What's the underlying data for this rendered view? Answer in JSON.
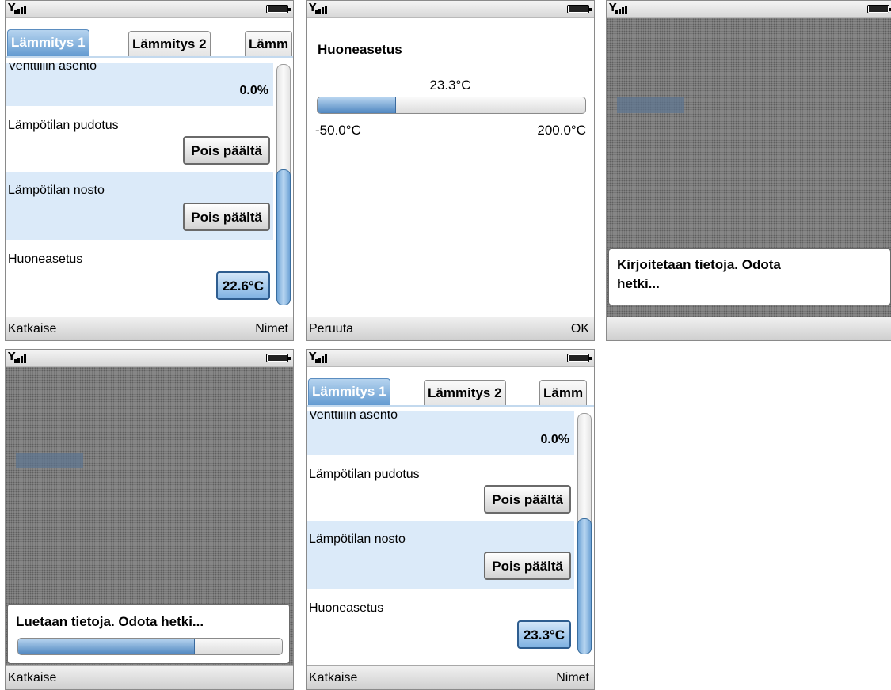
{
  "colors": {
    "accent": "#5e97cf",
    "row_alt": "#dbeaf9",
    "dim": "#8e8e8e"
  },
  "icons": {
    "signal": "signal-strength-icon",
    "battery": "battery-icon"
  },
  "screens": {
    "s1": {
      "tabs": [
        "Lämmitys 1",
        "Lämmitys 2",
        "Lämm"
      ],
      "rows": [
        {
          "label": "Venttiilin asento",
          "value": "0.0%"
        },
        {
          "label": "Lämpötilan pudotus",
          "button": "Pois päältä"
        },
        {
          "label": "Lämpötilan nosto",
          "button": "Pois päältä"
        },
        {
          "label": "Huoneasetus",
          "button": "22.6°C"
        }
      ],
      "softkeys": {
        "left": "Katkaise",
        "right": "Nimet"
      }
    },
    "s2": {
      "title": "Huoneasetus",
      "current": "23.3°C",
      "min": "-50.0°C",
      "max": "200.0°C",
      "level_fraction": 0.294,
      "softkeys": {
        "left": "Peruuta",
        "right": "OK"
      }
    },
    "s3": {
      "message": "Kirjoitetaan tietoja. Odota hetki...",
      "message_line1": "Kirjoitetaan tietoja. Odota",
      "message_line2": "hetki..."
    },
    "s4": {
      "message": "Luetaan tietoja. Odota hetki...",
      "progress_fraction": 0.67,
      "softkeys": {
        "left": "Katkaise"
      }
    },
    "s5": {
      "tabs": [
        "Lämmitys 1",
        "Lämmitys 2",
        "Lämm"
      ],
      "rows": [
        {
          "label": "Venttiilin asento",
          "value": "0.0%"
        },
        {
          "label": "Lämpötilan pudotus",
          "button": "Pois päältä"
        },
        {
          "label": "Lämpötilan nosto",
          "button": "Pois päältä"
        },
        {
          "label": "Huoneasetus",
          "button": "23.3°C"
        }
      ],
      "softkeys": {
        "left": "Katkaise",
        "right": "Nimet"
      }
    }
  }
}
